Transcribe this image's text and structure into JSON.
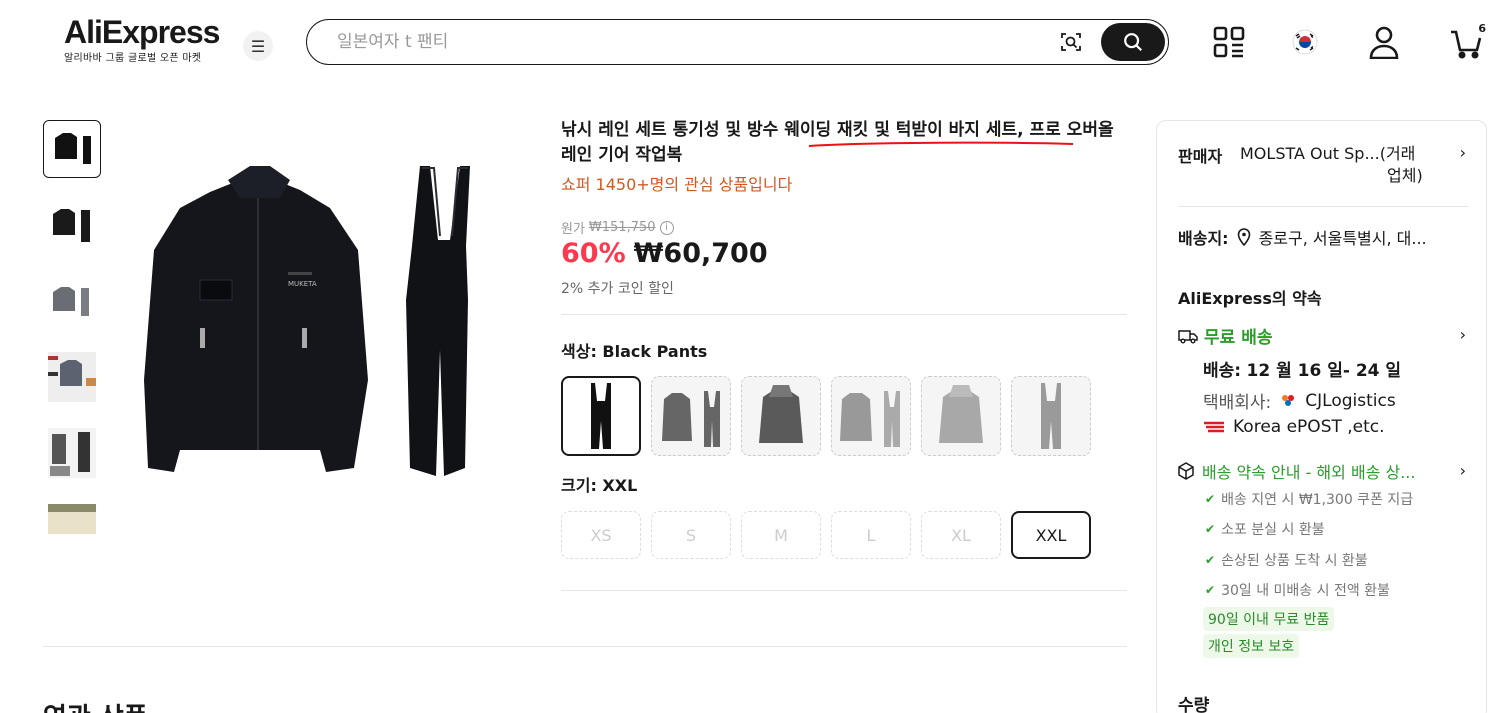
{
  "header": {
    "logo_text": "AliExpress",
    "logo_subtitle": "알리바바 그룹 글로벌 오픈 마켓",
    "search_placeholder": "일본여자 t 팬티",
    "cart_count": "6"
  },
  "product": {
    "title": "낚시 레인 세트 통기성 및 방수 웨이딩 재킷 및 턱받이 바지 세트, 프로 오버올 레인 기어 작업복",
    "interest_text": "쇼퍼 1450+명의 관심 상품입니다",
    "original_price_label": "원가",
    "original_price": "₩151,750",
    "discount": "60%",
    "price": "₩60,700",
    "coin_text": "2% 추가 코인 할인",
    "color_label": "색상:",
    "color_value": "Black Pants",
    "size_label": "크기:",
    "size_value": "XXL",
    "sizes": [
      "XS",
      "S",
      "M",
      "L",
      "XL",
      "XXL"
    ],
    "jacket_brand": "MUKETA"
  },
  "related_title": "연관 상품",
  "panel": {
    "seller_label": "판매자",
    "seller_name": "MOLSTA Out Sp...(거래",
    "seller_name_2": "업체)",
    "ship_to_label": "배송지:",
    "ship_to_value": "종로구, 서울특별시, 대...",
    "promise_title": "AliExpress의 약속",
    "free_shipping": "무료 배송",
    "delivery_label": "배송:",
    "delivery_value": "12 월 16 일- 24 일",
    "carrier_label": "택배회사:",
    "carrier_1": "CJLogistics",
    "carrier_2": "Korea ePOST ,etc.",
    "promise_guide": "배송 약속 안내 - 해외 배송 상...",
    "checks": [
      "배송 지연 시 ₩1,300 쿠폰 지급",
      "소포 분실 시 환불",
      "손상된 상품 도착 시 환불",
      "30일 내 미배송 시 전액 환불"
    ],
    "tag_return": "90일 이내 무료 반품",
    "tag_privacy": "개인 정보 보호",
    "quantity_label": "수량"
  },
  "colors": {
    "accent_red": "#fd384f",
    "interest_orange": "#d3581f",
    "promise_green": "#2a9d2a"
  }
}
